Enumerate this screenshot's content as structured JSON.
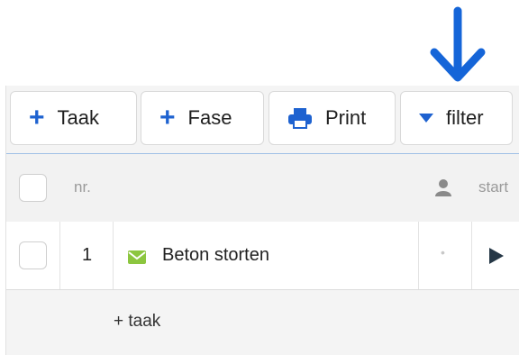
{
  "toolbar": {
    "add_task_label": "Taak",
    "add_phase_label": "Fase",
    "print_label": "Print",
    "filter_label": "filter"
  },
  "table": {
    "columns": {
      "nr": "nr.",
      "start": "start"
    },
    "rows": [
      {
        "nr": "1",
        "name": "Beton storten",
        "assignee": "•",
        "status_icon": "play-icon"
      }
    ],
    "add_task_label": "+ taak"
  },
  "colors": {
    "accent_blue": "#1e62d0",
    "task_icon_green": "#8cc63f",
    "annotation_arrow": "#1565d8"
  }
}
